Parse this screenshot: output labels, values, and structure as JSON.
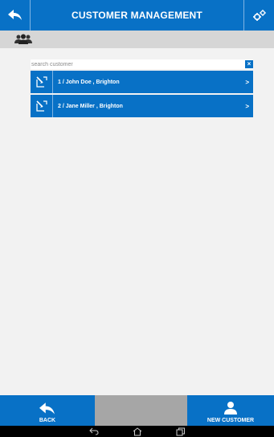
{
  "header": {
    "title": "CUSTOMER MANAGEMENT",
    "back_icon": "back-arrow-icon",
    "settings_icon": "gears-icon"
  },
  "subbar": {
    "icon": "people-group-icon"
  },
  "search": {
    "placeholder": "search customer",
    "value": "",
    "clear_label": "×"
  },
  "customers": [
    {
      "label": "1 / John Doe ,  Brighton",
      "chevron": ">"
    },
    {
      "label": "2 / Jane Miller ,  Brighton",
      "chevron": ">"
    }
  ],
  "footer": {
    "back_label": "BACK",
    "new_customer_label": "NEW CUSTOMER"
  },
  "colors": {
    "accent": "#0871c6",
    "background": "#f2f2f2",
    "subbar": "#d6d6d6",
    "disabled": "#a6a6a6"
  }
}
